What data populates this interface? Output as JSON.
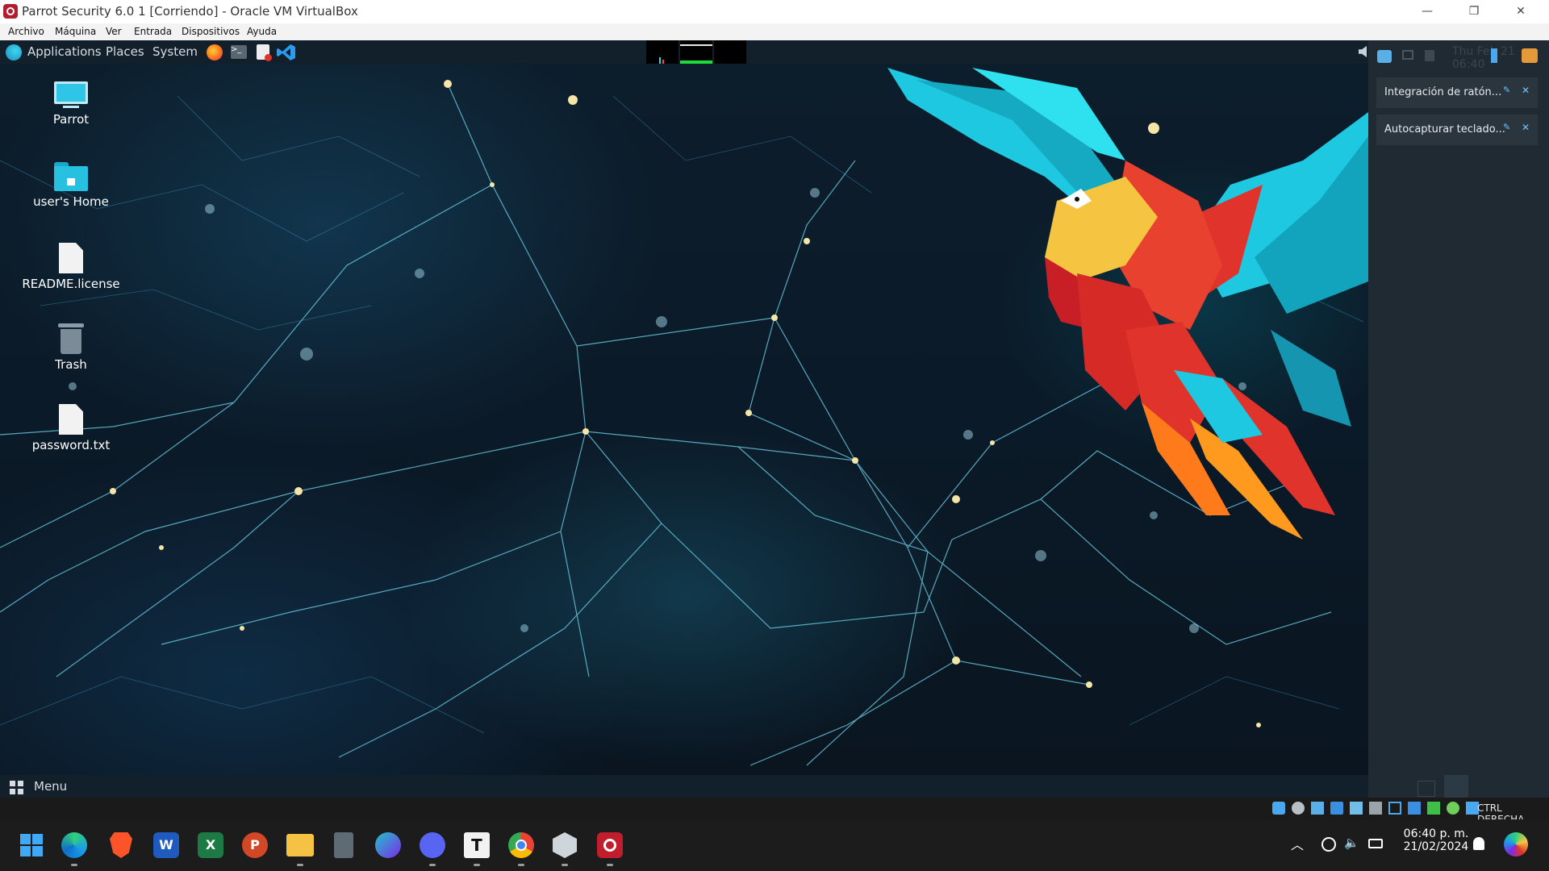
{
  "window": {
    "title": "Parrot Security 6.0 1 [Corriendo] - Oracle VM VirtualBox",
    "controls": {
      "minimize": "—",
      "restore": "❐",
      "close": "✕"
    }
  },
  "vbox_menu": [
    "Archivo",
    "Máquina",
    "Ver",
    "Entrada",
    "Dispositivos",
    "Ayuda"
  ],
  "guest_panel": {
    "applications": "Applications",
    "places": "Places",
    "system": "System",
    "clock_partial": "Thu Feb 21 06:40"
  },
  "desktop_icons": [
    {
      "label": "Parrot",
      "icon": "computer-icon"
    },
    {
      "label": "user's Home",
      "icon": "home-folder-icon"
    },
    {
      "label": "README.license",
      "icon": "document-icon"
    },
    {
      "label": "Trash",
      "icon": "trash-icon"
    },
    {
      "label": "password.txt",
      "icon": "document-icon"
    }
  ],
  "notifications": [
    {
      "text": "Integración de ratón..."
    },
    {
      "text": "Autocapturar teclado..."
    }
  ],
  "bottom_panel": {
    "menu": "Menu"
  },
  "vbox_status": {
    "host_key": "CTRL DERECHA"
  },
  "taskbar": {
    "apps": [
      "start-icon",
      "edge-icon",
      "brave-icon",
      "word-icon",
      "excel-icon",
      "powerpoint-icon",
      "file-explorer-icon",
      "calculator-icon",
      "canva-icon",
      "discord-icon",
      "typora-icon",
      "chrome-icon",
      "virtualbox-icon",
      "parrot-vm-icon"
    ],
    "time": "06:40 p. m.",
    "date": "21/02/2024"
  },
  "colors": {
    "guest_panel": "#12202c",
    "accent_cyan": "#1ec8e0",
    "parrot_red": "#e0332b"
  }
}
